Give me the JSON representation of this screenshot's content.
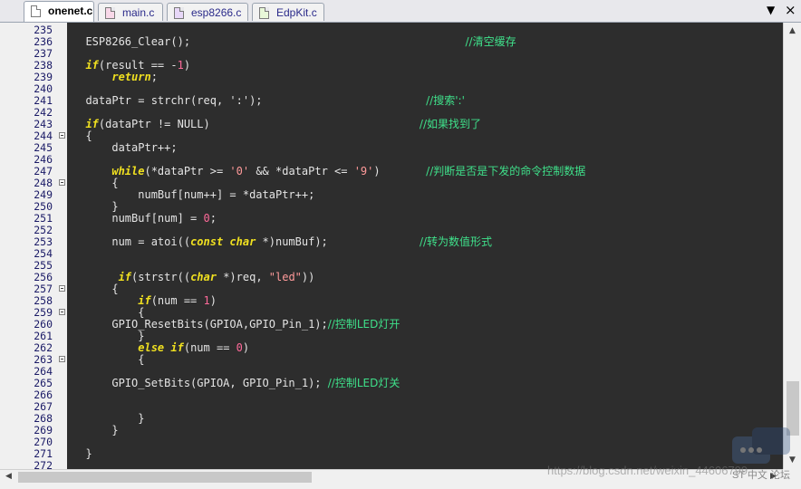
{
  "tabs": [
    {
      "label": "onenet.c",
      "active": true
    },
    {
      "label": "main.c",
      "active": false
    },
    {
      "label": "esp8266.c",
      "active": false
    },
    {
      "label": "EdpKit.c",
      "active": false
    }
  ],
  "window_controls": {
    "dropdown": "▼",
    "close": "×"
  },
  "lines": [
    {
      "n": "235",
      "fold": false,
      "tokens": []
    },
    {
      "n": "236",
      "fold": false,
      "tokens": [
        {
          "t": "  ESP8266_Clear();                                          "
        },
        {
          "t": "//清空缓存",
          "c": "cm"
        }
      ]
    },
    {
      "n": "237",
      "fold": false,
      "tokens": []
    },
    {
      "n": "238",
      "fold": false,
      "tokens": [
        {
          "t": "  "
        },
        {
          "t": "if",
          "c": "kw"
        },
        {
          "t": "(result == -"
        },
        {
          "t": "1",
          "c": "num"
        },
        {
          "t": ")"
        }
      ]
    },
    {
      "n": "239",
      "fold": false,
      "tokens": [
        {
          "t": "      "
        },
        {
          "t": "return",
          "c": "kw"
        },
        {
          "t": ";"
        }
      ]
    },
    {
      "n": "240",
      "fold": false,
      "tokens": []
    },
    {
      "n": "241",
      "fold": false,
      "tokens": [
        {
          "t": "  dataPtr = strchr(req, ':');                         "
        },
        {
          "t": "//搜索':'",
          "c": "cm"
        }
      ]
    },
    {
      "n": "242",
      "fold": false,
      "tokens": []
    },
    {
      "n": "243",
      "fold": false,
      "tokens": [
        {
          "t": "  "
        },
        {
          "t": "if",
          "c": "kw"
        },
        {
          "t": "(dataPtr != NULL)                                "
        },
        {
          "t": "//如果找到了",
          "c": "cm"
        }
      ]
    },
    {
      "n": "244",
      "fold": true,
      "tokens": [
        {
          "t": "  {"
        }
      ]
    },
    {
      "n": "245",
      "fold": false,
      "tokens": [
        {
          "t": "      dataPtr++;"
        }
      ]
    },
    {
      "n": "246",
      "fold": false,
      "tokens": []
    },
    {
      "n": "247",
      "fold": false,
      "tokens": [
        {
          "t": "      "
        },
        {
          "t": "while",
          "c": "kw"
        },
        {
          "t": "(*dataPtr >= "
        },
        {
          "t": "'0'",
          "c": "str"
        },
        {
          "t": " && *dataPtr <= "
        },
        {
          "t": "'9'",
          "c": "str"
        },
        {
          "t": ")       "
        },
        {
          "t": "//判断是否是下发的命令控制数据",
          "c": "cm"
        }
      ]
    },
    {
      "n": "248",
      "fold": true,
      "tokens": [
        {
          "t": "      {"
        }
      ]
    },
    {
      "n": "249",
      "fold": false,
      "tokens": [
        {
          "t": "          numBuf[num++] = *dataPtr++;"
        }
      ]
    },
    {
      "n": "250",
      "fold": false,
      "tokens": [
        {
          "t": "      }"
        }
      ]
    },
    {
      "n": "251",
      "fold": false,
      "tokens": [
        {
          "t": "      numBuf[num] = "
        },
        {
          "t": "0",
          "c": "num"
        },
        {
          "t": ";"
        }
      ]
    },
    {
      "n": "252",
      "fold": false,
      "tokens": []
    },
    {
      "n": "253",
      "fold": false,
      "tokens": [
        {
          "t": "      num = atoi(("
        },
        {
          "t": "const",
          "c": "kw"
        },
        {
          "t": " "
        },
        {
          "t": "char",
          "c": "kw"
        },
        {
          "t": " *)numBuf);              "
        },
        {
          "t": "//转为数值形式",
          "c": "cm"
        }
      ]
    },
    {
      "n": "254",
      "fold": false,
      "tokens": []
    },
    {
      "n": "255",
      "fold": false,
      "tokens": []
    },
    {
      "n": "256",
      "fold": false,
      "tokens": [
        {
          "t": "       "
        },
        {
          "t": "if",
          "c": "kw"
        },
        {
          "t": "(strstr(("
        },
        {
          "t": "char",
          "c": "kw"
        },
        {
          "t": " *)req, "
        },
        {
          "t": "\"led\"",
          "c": "str"
        },
        {
          "t": "))"
        }
      ]
    },
    {
      "n": "257",
      "fold": true,
      "tokens": [
        {
          "t": "      {"
        }
      ]
    },
    {
      "n": "258",
      "fold": false,
      "tokens": [
        {
          "t": "          "
        },
        {
          "t": "if",
          "c": "kw"
        },
        {
          "t": "(num == "
        },
        {
          "t": "1",
          "c": "num"
        },
        {
          "t": ")"
        }
      ]
    },
    {
      "n": "259",
      "fold": true,
      "tokens": [
        {
          "t": "          {"
        }
      ]
    },
    {
      "n": "260",
      "fold": false,
      "tokens": [
        {
          "t": "      GPIO_ResetBits(GPIOA,GPIO_Pin_1);"
        },
        {
          "t": "//控制LED灯开",
          "c": "cm"
        }
      ]
    },
    {
      "n": "261",
      "fold": false,
      "tokens": [
        {
          "t": "          }"
        }
      ]
    },
    {
      "n": "262",
      "fold": false,
      "tokens": [
        {
          "t": "          "
        },
        {
          "t": "else",
          "c": "kw"
        },
        {
          "t": " "
        },
        {
          "t": "if",
          "c": "kw"
        },
        {
          "t": "(num == "
        },
        {
          "t": "0",
          "c": "num"
        },
        {
          "t": ")"
        }
      ]
    },
    {
      "n": "263",
      "fold": true,
      "tokens": [
        {
          "t": "          {"
        }
      ]
    },
    {
      "n": "264",
      "fold": false,
      "tokens": []
    },
    {
      "n": "265",
      "fold": false,
      "tokens": [
        {
          "t": "      GPIO_SetBits(GPIOA, GPIO_Pin_1); "
        },
        {
          "t": "//控制LED灯关",
          "c": "cm"
        }
      ]
    },
    {
      "n": "266",
      "fold": false,
      "tokens": []
    },
    {
      "n": "267",
      "fold": false,
      "tokens": []
    },
    {
      "n": "268",
      "fold": false,
      "tokens": [
        {
          "t": "          }"
        }
      ]
    },
    {
      "n": "269",
      "fold": false,
      "tokens": [
        {
          "t": "      }"
        }
      ]
    },
    {
      "n": "270",
      "fold": false,
      "tokens": []
    },
    {
      "n": "271",
      "fold": false,
      "tokens": [
        {
          "t": "  }"
        }
      ]
    },
    {
      "n": "272",
      "fold": false,
      "tokens": []
    }
  ],
  "watermark": "https://blog.csdn.net/weixin_44606799",
  "ime_indicator": "ST 中文 论坛",
  "scroll_arrows": {
    "up": "▲",
    "down": "▼",
    "left": "◀",
    "right": "▶"
  }
}
